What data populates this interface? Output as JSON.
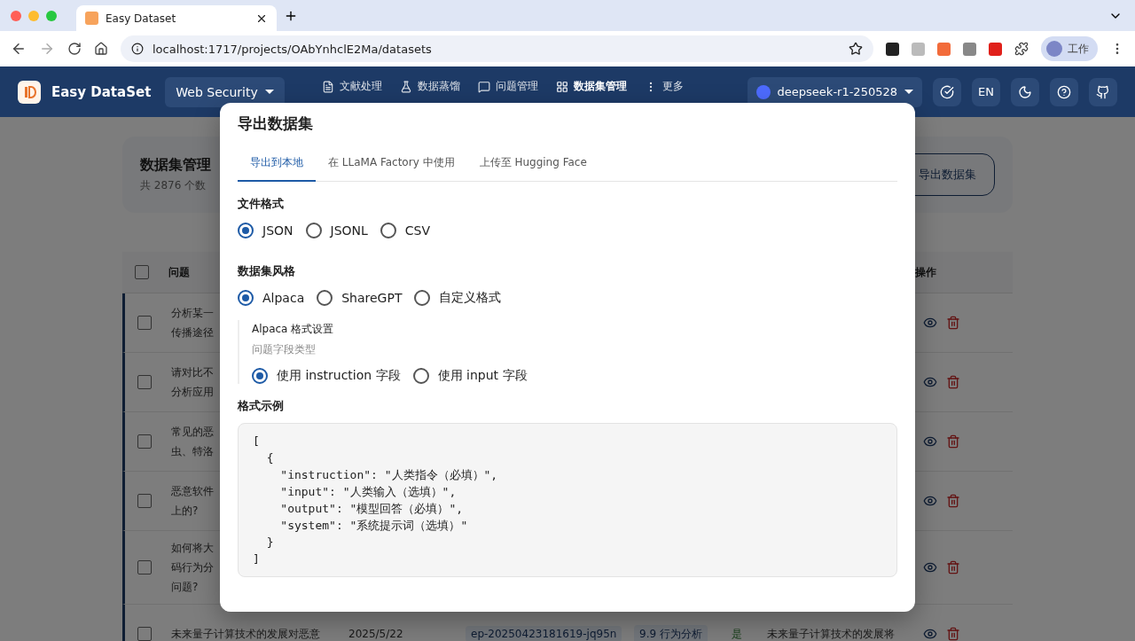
{
  "browser": {
    "tab_title": "Easy Dataset",
    "url": "localhost:1717/projects/OAbYnhclE2Ma/datasets",
    "profile": "工作"
  },
  "app": {
    "brand": "Easy DataSet",
    "project": "Web Security",
    "nav": [
      {
        "label": "文献处理",
        "selected": false
      },
      {
        "label": "数据蒸馏",
        "selected": false
      },
      {
        "label": "问题管理",
        "selected": false
      },
      {
        "label": "数据集管理",
        "selected": true
      },
      {
        "label": "更多",
        "selected": false
      }
    ],
    "model": "deepseek-r1-250528",
    "lang": "EN"
  },
  "page": {
    "title": "数据集管理",
    "subtitle": "共 2876 个数",
    "export_button": "导出数据集",
    "select_all": {
      "checked": false
    },
    "columns": [
      "问题",
      "操作"
    ],
    "rows": [
      {
        "checked": false,
        "question": [
          "分析某一",
          "传播途径"
        ]
      },
      {
        "checked": false,
        "question": [
          "请对比不",
          "分析应用"
        ]
      },
      {
        "checked": false,
        "question": [
          "常见的恶",
          "虫、特洛"
        ]
      },
      {
        "checked": false,
        "question": [
          "恶意软件",
          "上的?"
        ]
      },
      {
        "checked": false,
        "question": [
          "如何将大",
          "码行为分",
          "问题?"
        ]
      },
      {
        "checked": false,
        "question": [
          "未来量子计算技术的发展对恶意"
        ],
        "date": "2025/5/22",
        "model": "ep-20250423181619-jq95n",
        "tag": "9.9 行为分析",
        "confirmed": "是",
        "answer": "未来量子计算技术的发展将"
      }
    ]
  },
  "dialog": {
    "title": "导出数据集",
    "tabs": [
      {
        "label": "导出到本地",
        "selected": true
      },
      {
        "label": "在 LLaMA Factory 中使用",
        "selected": false
      },
      {
        "label": "上传至 Hugging Face",
        "selected": false
      }
    ],
    "file_format": {
      "label": "文件格式",
      "options": [
        {
          "label": "JSON",
          "selected": true
        },
        {
          "label": "JSONL",
          "selected": false
        },
        {
          "label": "CSV",
          "selected": false
        }
      ]
    },
    "style": {
      "label": "数据集风格",
      "options": [
        {
          "label": "Alpaca",
          "selected": true
        },
        {
          "label": "ShareGPT",
          "selected": false
        },
        {
          "label": "自定义格式",
          "selected": false
        }
      ]
    },
    "alpaca": {
      "title": "Alpaca 格式设置",
      "subtitle": "问题字段类型",
      "options": [
        {
          "label": "使用 instruction 字段",
          "selected": true
        },
        {
          "label": "使用 input 字段",
          "selected": false
        }
      ]
    },
    "example": {
      "label": "格式示例",
      "lines": [
        "[",
        "  {",
        "    \"instruction\": \"人类指令（必填）\",",
        "    \"input\": \"人类输入（选填）\",",
        "    \"output\": \"模型回答（必填）\",",
        "    \"system\": \"系统提示词（选填）\"",
        "  }",
        "]"
      ]
    }
  }
}
